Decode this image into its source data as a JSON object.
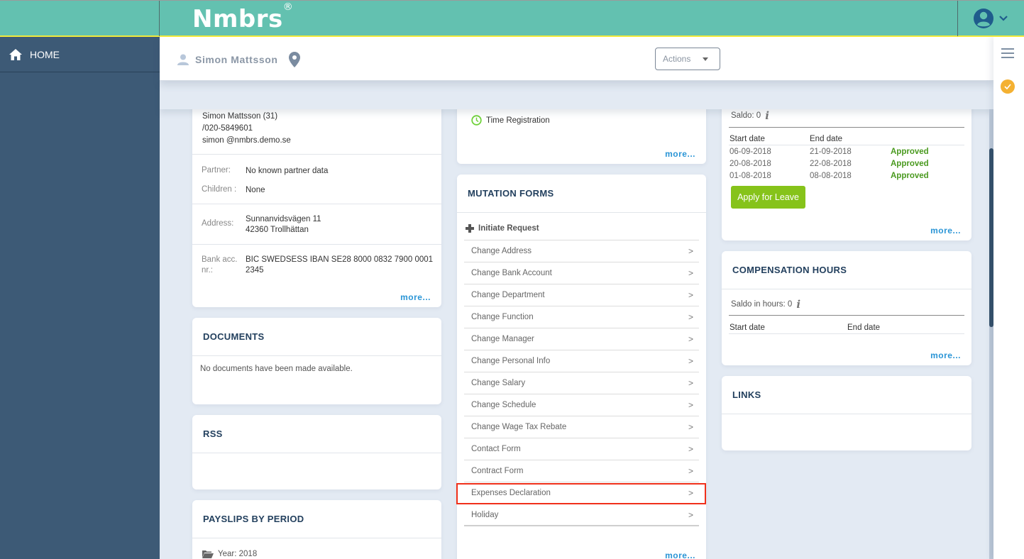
{
  "app": {
    "logo": "Nmbrs",
    "logo_mark": "®"
  },
  "sidebar": {
    "items": [
      {
        "label": "HOME",
        "icon": "home-icon"
      }
    ]
  },
  "header": {
    "person_name": "Simon Mattsson",
    "actions_label": "Actions"
  },
  "profile": {
    "name_line": "Simon Mattsson (31)",
    "phone": "/020-5849601",
    "email": "simon @nmbrs.demo.se",
    "partner_label": "Partner:",
    "partner_value": "No known partner data",
    "children_label": "Children :",
    "children_value": "None",
    "address_label": "Address:",
    "address_line1": "Sunnanvidsvägen 11",
    "address_line2": "42360 Trollhättan",
    "bank_label_1": "Bank acc.",
    "bank_label_2": "nr.:",
    "bank_value_1": "BIC SWEDSESS IBAN SE28 8000 0832 7900 0001",
    "bank_value_2": "2345",
    "more": "more..."
  },
  "documents": {
    "title": "DOCUMENTS",
    "empty": "No documents have been made available."
  },
  "rss": {
    "title": "RSS"
  },
  "payslips": {
    "title": "PAYSLIPS BY PERIOD",
    "year": "Year: 2018"
  },
  "time_registration": {
    "item": "Time Registration",
    "more": "more..."
  },
  "mutation_forms": {
    "title": "MUTATION FORMS",
    "initiate": "Initiate Request",
    "items": [
      "Change Address",
      "Change Bank Account",
      "Change Department",
      "Change Function",
      "Change Manager",
      "Change Personal Info",
      "Change Salary",
      "Change Schedule",
      "Change Wage Tax Rebate",
      "Contact Form",
      "Contract Form",
      "Expenses Declaration",
      "Holiday"
    ],
    "highlighted": "Expenses Declaration",
    "more": "more..."
  },
  "leave": {
    "saldo": "Saldo: 0",
    "headers": [
      "Start date",
      "End date"
    ],
    "rows": [
      {
        "start": "06-09-2018",
        "end": "21-09-2018",
        "status": "Approved"
      },
      {
        "start": "20-08-2018",
        "end": "22-08-2018",
        "status": "Approved"
      },
      {
        "start": "01-08-2018",
        "end": "08-08-2018",
        "status": "Approved"
      }
    ],
    "apply_label": "Apply for Leave",
    "more": "more..."
  },
  "compensation": {
    "title": "COMPENSATION HOURS",
    "saldo": "Saldo in hours: 0",
    "headers": [
      "Start date",
      "End date"
    ],
    "more": "more..."
  },
  "links": {
    "title": "LINKS"
  },
  "colors": {
    "topbar": "#63c1b0",
    "sidebar": "#3d5a76",
    "accent_green": "#86c31a",
    "approved": "#4a9a1f",
    "link": "#2a95d6",
    "highlight": "#f0301a"
  }
}
